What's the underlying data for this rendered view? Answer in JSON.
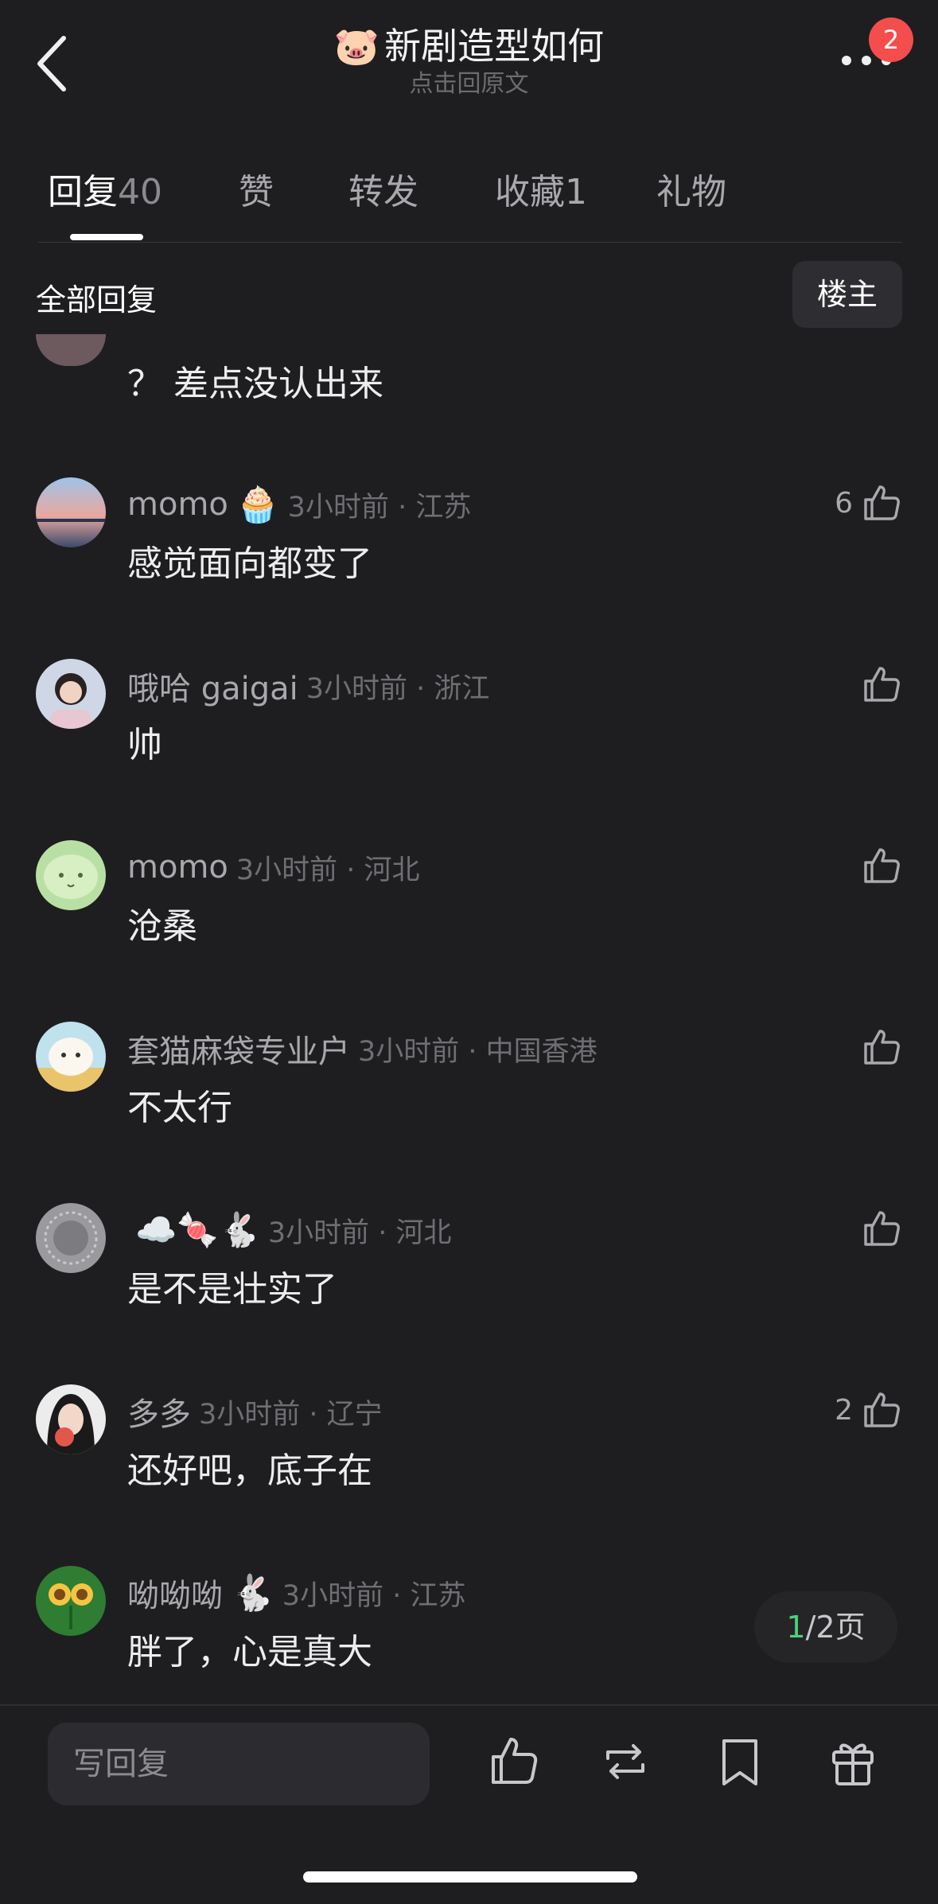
{
  "header": {
    "title": "新剧造型如何",
    "title_emoji": "🐷",
    "subtitle": "点击回原文",
    "badge_count": "2"
  },
  "tabs": [
    {
      "label": "回复",
      "count": "40",
      "active": true
    },
    {
      "label": "赞",
      "count": "",
      "active": false
    },
    {
      "label": "转发",
      "count": "",
      "active": false
    },
    {
      "label": "收藏",
      "count": "1",
      "active": false
    },
    {
      "label": "礼物",
      "count": "",
      "active": false
    }
  ],
  "filter": {
    "label": "全部回复",
    "owner_button": "楼主"
  },
  "partial_comment": {
    "text": "？ 差点没认出来"
  },
  "comments": [
    {
      "user": "momo",
      "user_emoji": "🧁",
      "time_loc": "3小时前 · 江苏",
      "text": "感觉面向都变了",
      "likes": "6"
    },
    {
      "user": "哦哈 gaigai",
      "user_emoji": "",
      "time_loc": "3小时前 · 浙江",
      "text": "帅",
      "likes": ""
    },
    {
      "user": "momo",
      "user_emoji": "",
      "time_loc": "3小时前 · 河北",
      "text": "沧桑",
      "likes": ""
    },
    {
      "user": "套猫麻袋专业户",
      "user_emoji": "",
      "time_loc": "3小时前 · 中国香港",
      "text": "不太行",
      "likes": ""
    },
    {
      "user": "",
      "user_emoji": "☁️🍬🐇",
      "time_loc": "3小时前 · 河北",
      "text": "是不是壮实了",
      "likes": ""
    },
    {
      "user": "多多",
      "user_emoji": "",
      "time_loc": "3小时前 · 辽宁",
      "text": "还好吧，底子在",
      "likes": "2"
    },
    {
      "user": "呦呦呦",
      "user_emoji": "🐇",
      "time_loc": "3小时前 · 江苏",
      "text": "胖了，心是真大",
      "likes": ""
    }
  ],
  "pagination": {
    "current": "1",
    "rest": "/2页"
  },
  "bottom_bar": {
    "reply_placeholder": "写回复"
  },
  "colors": {
    "background": "#1e1e20",
    "badge": "#f44d4d",
    "page_current": "#4cd27a"
  }
}
